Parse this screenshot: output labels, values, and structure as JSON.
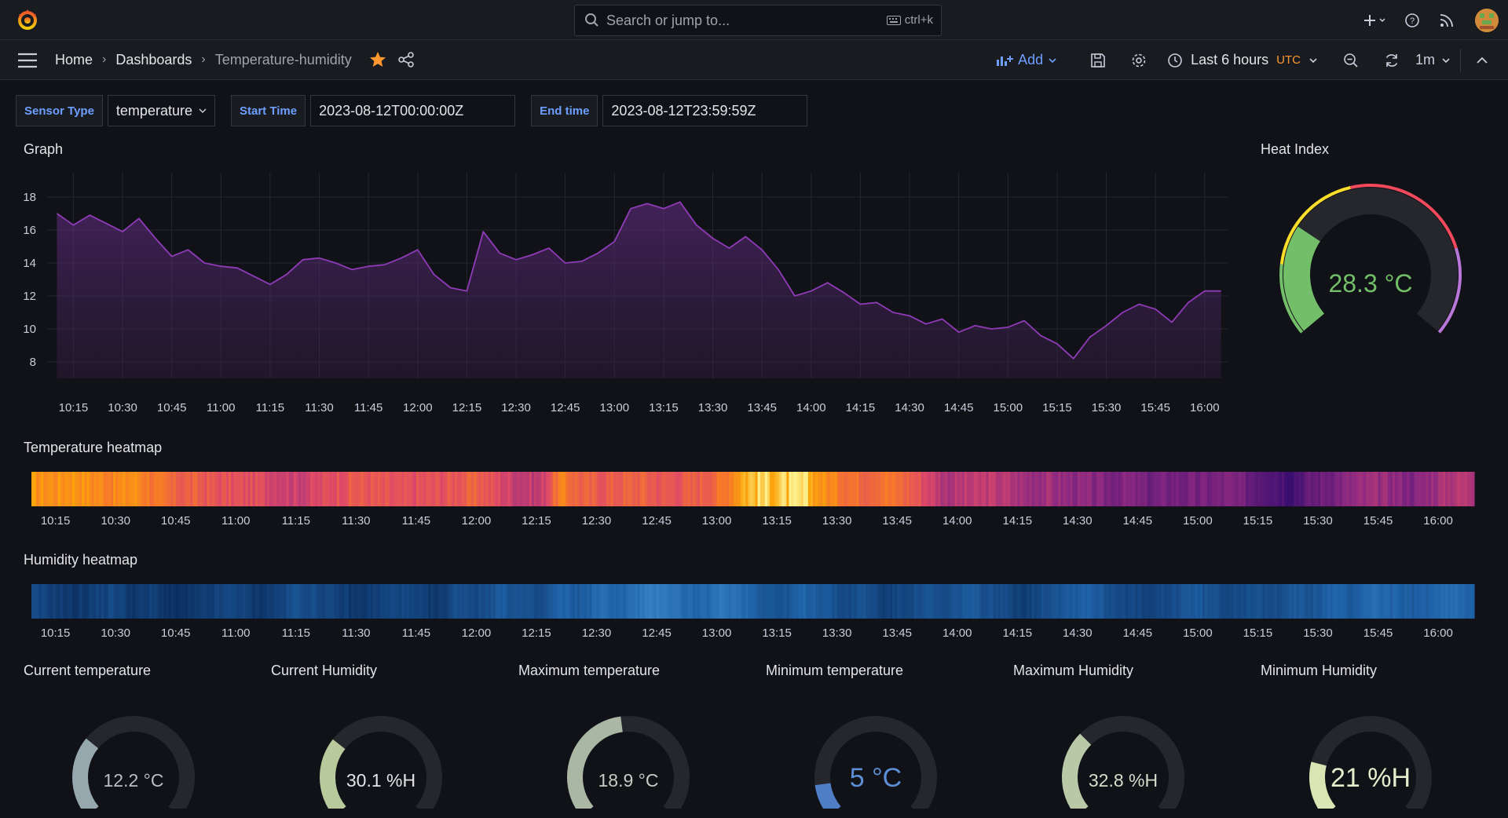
{
  "topbar": {
    "search_placeholder": "Search or jump to...",
    "search_shortcut": "ctrl+k"
  },
  "breadcrumb": {
    "home": "Home",
    "dashboards": "Dashboards",
    "current": "Temperature-humidity"
  },
  "toolbar": {
    "add_label": "Add",
    "time_range": "Last 6 hours",
    "timezone": "UTC",
    "refresh_interval": "1m"
  },
  "variables": {
    "sensor_type_label": "Sensor Type",
    "sensor_type_value": "temperature",
    "start_time_label": "Start Time",
    "start_time_value": "2023-08-12T00:00:00Z",
    "end_time_label": "End time",
    "end_time_value": "2023-08-12T23:59:59Z"
  },
  "panels": {
    "graph_title": "Graph",
    "heat_index_title": "Heat Index",
    "temp_heatmap_title": "Temperature heatmap",
    "hum_heatmap_title": "Humidity heatmap"
  },
  "heat_index": {
    "value": 28.3,
    "display": "28.3 °C",
    "min": 0,
    "max": 100,
    "color": "#73bf69"
  },
  "time_ticks": [
    "10:15",
    "10:30",
    "10:45",
    "11:00",
    "11:15",
    "11:30",
    "11:45",
    "12:00",
    "12:15",
    "12:30",
    "12:45",
    "13:00",
    "13:15",
    "13:30",
    "13:45",
    "14:00",
    "14:15",
    "14:30",
    "14:45",
    "15:00",
    "15:15",
    "15:30",
    "15:45",
    "16:00"
  ],
  "chart_data": {
    "type": "area",
    "title": "Graph",
    "y_ticks": [
      8,
      10,
      12,
      14,
      16,
      18
    ],
    "ylim": [
      7,
      19
    ],
    "x": [
      "10:10",
      "10:15",
      "10:20",
      "10:25",
      "10:30",
      "10:35",
      "10:40",
      "10:45",
      "10:50",
      "10:55",
      "11:00",
      "11:05",
      "11:10",
      "11:15",
      "11:20",
      "11:25",
      "11:30",
      "11:35",
      "11:40",
      "11:45",
      "11:50",
      "11:55",
      "12:00",
      "12:05",
      "12:10",
      "12:15",
      "12:20",
      "12:25",
      "12:30",
      "12:35",
      "12:40",
      "12:45",
      "12:50",
      "12:55",
      "13:00",
      "13:05",
      "13:10",
      "13:15",
      "13:20",
      "13:25",
      "13:30",
      "13:35",
      "13:40",
      "13:45",
      "13:50",
      "13:55",
      "14:00",
      "14:05",
      "14:10",
      "14:15",
      "14:20",
      "14:25",
      "14:30",
      "14:35",
      "14:40",
      "14:45",
      "14:50",
      "14:55",
      "15:00",
      "15:05",
      "15:10",
      "15:15",
      "15:20",
      "15:25",
      "15:30",
      "15:35",
      "15:40",
      "15:45",
      "15:50",
      "15:55",
      "16:00",
      "16:05"
    ],
    "series": [
      {
        "values": [
          17.0,
          16.3,
          16.9,
          16.4,
          15.9,
          16.7,
          15.5,
          14.4,
          14.8,
          14.0,
          13.8,
          13.7,
          13.2,
          12.7,
          13.3,
          14.2,
          14.3,
          14.0,
          13.6,
          13.8,
          13.9,
          14.3,
          14.8,
          13.3,
          12.5,
          12.3,
          15.9,
          14.6,
          14.2,
          14.5,
          14.9,
          14.0,
          14.1,
          14.6,
          15.3,
          17.3,
          17.6,
          17.3,
          17.7,
          16.3,
          15.5,
          14.9,
          15.6,
          14.8,
          13.6,
          12.0,
          12.3,
          12.8,
          12.2,
          11.5,
          11.6,
          11.0,
          10.8,
          10.3,
          10.6,
          9.8,
          10.2,
          10.0,
          10.1,
          10.5,
          9.6,
          9.1,
          8.2,
          9.5,
          10.2,
          11.0,
          11.5,
          11.2,
          10.4,
          11.6,
          12.3,
          12.3
        ],
        "color": "#8f3bb8"
      }
    ]
  },
  "heatmaps": {
    "temperature": {
      "palette": "inferno",
      "values": [
        16.5,
        16.3,
        16.7,
        16.2,
        15.9,
        16.4,
        15.4,
        14.6,
        14.5,
        14.0,
        13.8,
        13.7,
        13.3,
        12.9,
        13.3,
        14.0,
        14.3,
        14.0,
        13.7,
        13.8,
        13.9,
        14.3,
        14.6,
        13.5,
        12.7,
        12.5,
        15.8,
        14.6,
        14.3,
        14.5,
        14.7,
        14.1,
        14.2,
        14.6,
        15.3,
        17.2,
        17.6,
        17.4,
        17.6,
        16.3,
        15.5,
        15.0,
        15.5,
        14.8,
        13.6,
        12.0,
        12.3,
        12.6,
        12.2,
        11.5,
        11.6,
        11.1,
        10.8,
        10.4,
        10.6,
        9.9,
        10.2,
        10.1,
        10.1,
        10.4,
        9.7,
        9.2,
        8.4,
        9.5,
        10.2,
        11.0,
        11.4,
        11.2,
        10.5,
        11.5,
        12.2,
        12.3
      ],
      "range": [
        8,
        18
      ]
    },
    "humidity": {
      "palette": "blues",
      "values": [
        24,
        23,
        22,
        23,
        24,
        22,
        23,
        21,
        22,
        23,
        24,
        22,
        23,
        25,
        24,
        23,
        22,
        23,
        24,
        23,
        22,
        25,
        24,
        26,
        25,
        24,
        27,
        26,
        28,
        27,
        29,
        30,
        28,
        27,
        29,
        28,
        26,
        25,
        27,
        26,
        24,
        25,
        23,
        24,
        25,
        24,
        26,
        25,
        24,
        23,
        25,
        26,
        27,
        25,
        24,
        23,
        24,
        26,
        25,
        24,
        25,
        24,
        26,
        25,
        27,
        26,
        28,
        27,
        26,
        27,
        28,
        27
      ],
      "range": [
        21,
        33
      ]
    }
  },
  "stat_gauges": [
    {
      "title": "Current temperature",
      "value": 12.2,
      "display": "12.2 °C",
      "min": 0,
      "max": 40,
      "color": "#96a7ad",
      "text_color": "#b7bfc4"
    },
    {
      "title": "Current Humidity",
      "value": 30.1,
      "display": "30.1 %H",
      "min": 0,
      "max": 100,
      "color": "#b8ca9c",
      "text_color": "#e3e4e8"
    },
    {
      "title": "Maximum temperature",
      "value": 18.9,
      "display": "18.9 °C",
      "min": 0,
      "max": 40,
      "color": "#a9b7a4",
      "text_color": "#c6ccc3"
    },
    {
      "title": "Minimum temperature",
      "value": 5,
      "display": "5 °C",
      "min": 0,
      "max": 40,
      "color": "#4f7ec6",
      "text_color": "#5c8fd6"
    },
    {
      "title": "Maximum Humidity",
      "value": 32.8,
      "display": "32.8 %H",
      "min": 0,
      "max": 100,
      "color": "#b9c9a8",
      "text_color": "#d7dccb"
    },
    {
      "title": "Minimum Humidity",
      "value": 21,
      "display": "21 %H",
      "min": 0,
      "max": 100,
      "color": "#d9e5b3",
      "text_color": "#e6edcc"
    }
  ]
}
